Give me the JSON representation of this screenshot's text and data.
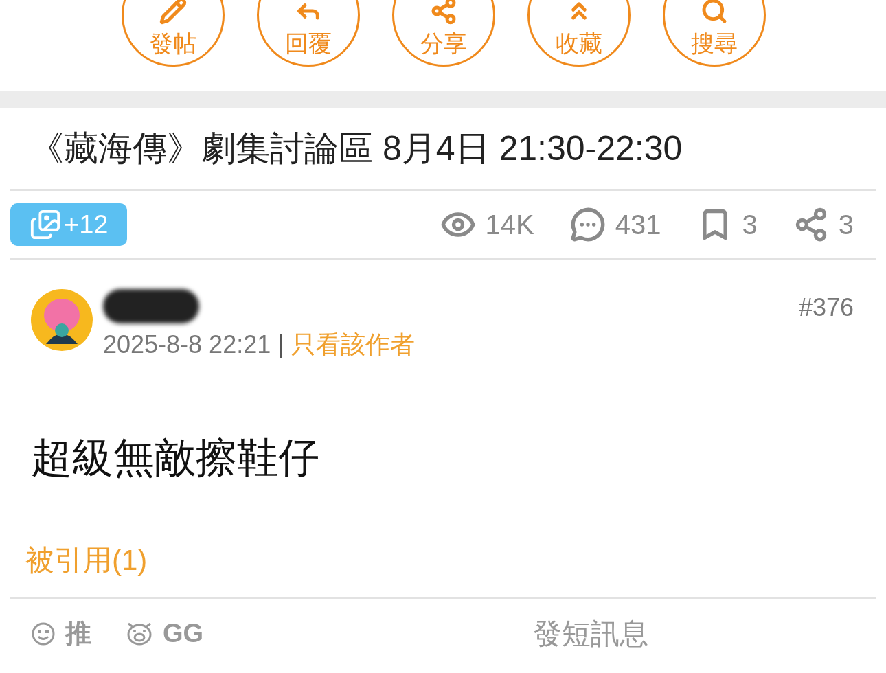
{
  "actions": [
    {
      "kind": "post",
      "label": "發帖"
    },
    {
      "kind": "reply",
      "label": "回覆"
    },
    {
      "kind": "share",
      "label": "分享"
    },
    {
      "kind": "collect",
      "label": "收藏"
    },
    {
      "kind": "search",
      "label": "搜尋"
    }
  ],
  "thread": {
    "title": "《藏海傳》劇集討論區 8月4日 21:30-22:30",
    "images_badge": "+12",
    "stats": [
      {
        "kind": "views",
        "value": "14K"
      },
      {
        "kind": "comments",
        "value": "431"
      },
      {
        "kind": "bookmarks",
        "value": "3"
      },
      {
        "kind": "shares",
        "value": "3"
      }
    ]
  },
  "post": {
    "number": "#376",
    "timestamp": "2025-8-8 22:21",
    "separator": "|",
    "author_only_link": "只看該作者",
    "body": "超級無敵擦鞋仔",
    "quoted_link": "被引用(1)",
    "footer": [
      {
        "kind": "push",
        "label": "推"
      },
      {
        "kind": "gg",
        "label": "GG"
      }
    ],
    "message_link": "發短訊息"
  }
}
